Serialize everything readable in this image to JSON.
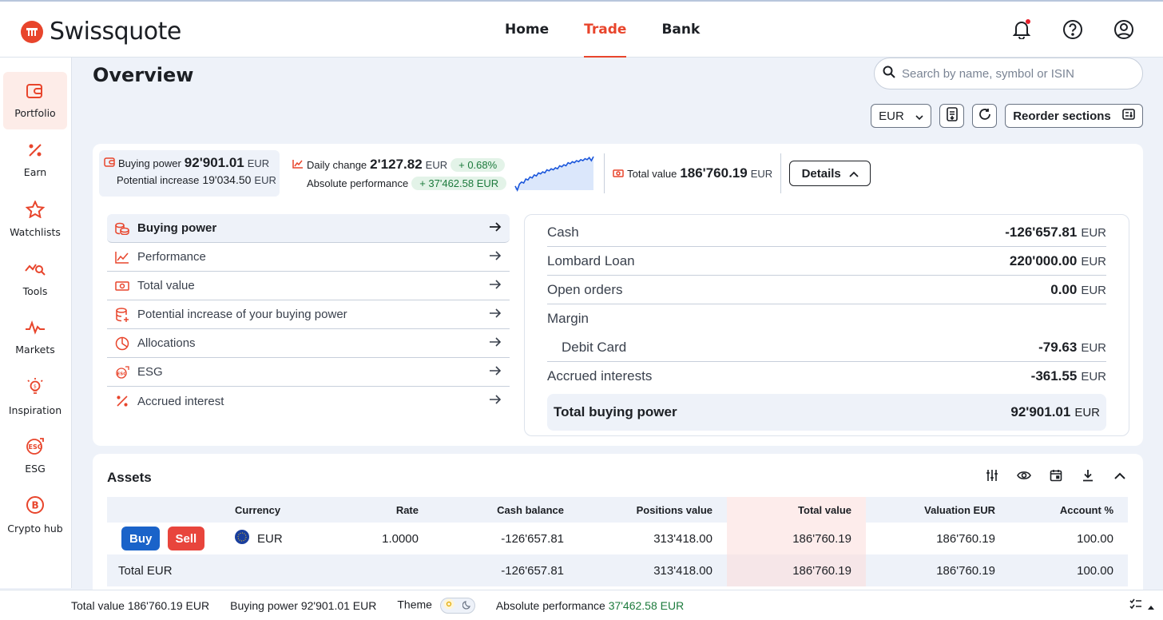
{
  "brand": {
    "name": "Swissquote",
    "accent": "#e8452c"
  },
  "topnav": {
    "items": [
      {
        "label": "Home"
      },
      {
        "label": "Trade",
        "active": true
      },
      {
        "label": "Bank"
      }
    ]
  },
  "sidebar": {
    "items": [
      {
        "label": "Portfolio",
        "icon": "wallet-icon",
        "active": true
      },
      {
        "label": "Earn",
        "icon": "percent-icon"
      },
      {
        "label": "Watchlists",
        "icon": "star-icon"
      },
      {
        "label": "Tools",
        "icon": "chart-search-icon"
      },
      {
        "label": "Markets",
        "icon": "pulse-icon"
      },
      {
        "label": "Inspiration",
        "icon": "lightbulb-icon"
      },
      {
        "label": "ESG",
        "icon": "esg-icon"
      },
      {
        "label": "Crypto hub",
        "icon": "bitcoin-icon"
      }
    ]
  },
  "page": {
    "title": "Overview"
  },
  "search": {
    "placeholder": "Search by name, symbol or ISIN"
  },
  "controls": {
    "currency": "EUR",
    "reorder_label": "Reorder sections"
  },
  "stats": {
    "buying_power_label": "Buying power",
    "buying_power_value": "92'901.01",
    "potential_increase_label": "Potential increase",
    "potential_increase_value": "19'034.50",
    "daily_change_label": "Daily change",
    "daily_change_value": "2'127.82",
    "daily_change_pct": "+ 0.68%",
    "absolute_performance_label": "Absolute performance",
    "absolute_performance_value": "+ 37'462.58  EUR",
    "total_value_label": "Total value",
    "total_value_value": "186'760.19",
    "currency": "EUR",
    "details_label": "Details"
  },
  "sparkline": {
    "values": [
      10,
      6,
      12,
      14,
      13,
      17,
      16,
      19,
      18,
      21,
      20,
      23,
      22,
      24,
      23,
      26,
      25,
      27,
      26,
      28,
      27,
      30,
      29,
      31,
      30,
      33,
      32,
      34,
      33,
      35,
      34,
      36,
      35,
      37,
      36,
      38,
      35,
      39
    ],
    "color": "#1a56db"
  },
  "menu": {
    "items": [
      {
        "label": "Buying power",
        "icon": "coins-icon",
        "active": true
      },
      {
        "label": "Performance",
        "icon": "trend-icon"
      },
      {
        "label": "Total value",
        "icon": "banknote-icon"
      },
      {
        "label": "Potential increase of your buying power",
        "icon": "database-plus-icon"
      },
      {
        "label": "Allocations",
        "icon": "pie-icon"
      },
      {
        "label": "ESG",
        "icon": "esg-icon"
      },
      {
        "label": "Accrued interest",
        "icon": "percent-icon"
      }
    ]
  },
  "buying_power_panel": {
    "rows": [
      {
        "label": "Cash",
        "value": "-126'657.81",
        "currency": "EUR"
      },
      {
        "label": "Lombard Loan",
        "value": "220'000.00",
        "currency": "EUR"
      },
      {
        "label": "Open orders",
        "value": "0.00",
        "currency": "EUR"
      },
      {
        "label": "Margin",
        "value": "",
        "currency": ""
      },
      {
        "label": "Debit Card",
        "value": "-79.63",
        "currency": "EUR"
      },
      {
        "label": "Accrued interests",
        "value": "-361.55",
        "currency": "EUR"
      }
    ],
    "total_label": "Total buying power",
    "total_value": "92'901.01",
    "total_currency": "EUR"
  },
  "assets": {
    "title": "Assets",
    "columns": [
      "",
      "Currency",
      "Rate",
      "Cash balance",
      "Positions value",
      "Total value",
      "Valuation EUR",
      "Account %"
    ],
    "row": {
      "buy": "Buy",
      "sell": "Sell",
      "currency": "EUR",
      "rate": "1.0000",
      "cash_balance": "-126'657.81",
      "positions_value": "313'418.00",
      "total_value": "186'760.19",
      "valuation": "186'760.19",
      "account_pct": "100.00"
    },
    "total": {
      "label": "Total EUR",
      "cash_balance": "-126'657.81",
      "positions_value": "313'418.00",
      "total_value": "186'760.19",
      "valuation": "186'760.19",
      "account_pct": "100.00"
    }
  },
  "bottombar": {
    "total_value": "Total value 186'760.19 EUR",
    "buying_power": "Buying power 92'901.01 EUR",
    "theme_label": "Theme",
    "absolute_performance_label": "Absolute performance",
    "absolute_performance_value": "37'462.58 EUR"
  }
}
